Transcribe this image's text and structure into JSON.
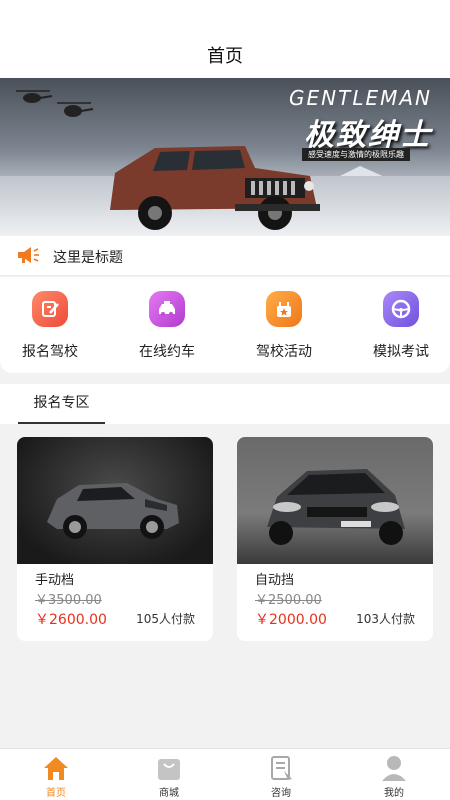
{
  "header": {
    "title": "首页"
  },
  "banner": {
    "headline_en": "GENTLEMAN",
    "headline_cn": "极致绅士",
    "subline": "感受速度与激情的极限乐趣"
  },
  "notice": {
    "text": "这里是标题",
    "icon": "megaphone-icon",
    "icon_color": "#f07a1f"
  },
  "quick_actions": [
    {
      "label": "报名驾校",
      "icon": "edit-note-icon",
      "color": "#f25a4a"
    },
    {
      "label": "在线约车",
      "icon": "car-icon",
      "color": "#c64ad8"
    },
    {
      "label": "驾校活动",
      "icon": "gift-star-icon",
      "color": "#f5861f"
    },
    {
      "label": "模拟考试",
      "icon": "steering-wheel-icon",
      "color": "#8a68e8"
    }
  ],
  "section": {
    "tab_label": "报名专区"
  },
  "products": [
    {
      "name": "手动档",
      "original_price": "￥3500.00",
      "price": "￥2600.00",
      "paid_count": "105人付款"
    },
    {
      "name": "自动挡",
      "original_price": "￥2500.00",
      "price": "￥2000.00",
      "paid_count": "103人付款"
    }
  ],
  "bottom_nav": [
    {
      "label": "首页",
      "icon": "home-icon",
      "active": true
    },
    {
      "label": "商城",
      "icon": "shopping-bag-icon",
      "active": false
    },
    {
      "label": "咨询",
      "icon": "consult-document-icon",
      "active": false
    },
    {
      "label": "我的",
      "icon": "user-icon",
      "active": false
    }
  ],
  "colors": {
    "accent": "#f28a24",
    "price_red": "#e8301c",
    "background": "#f2f2f2"
  }
}
